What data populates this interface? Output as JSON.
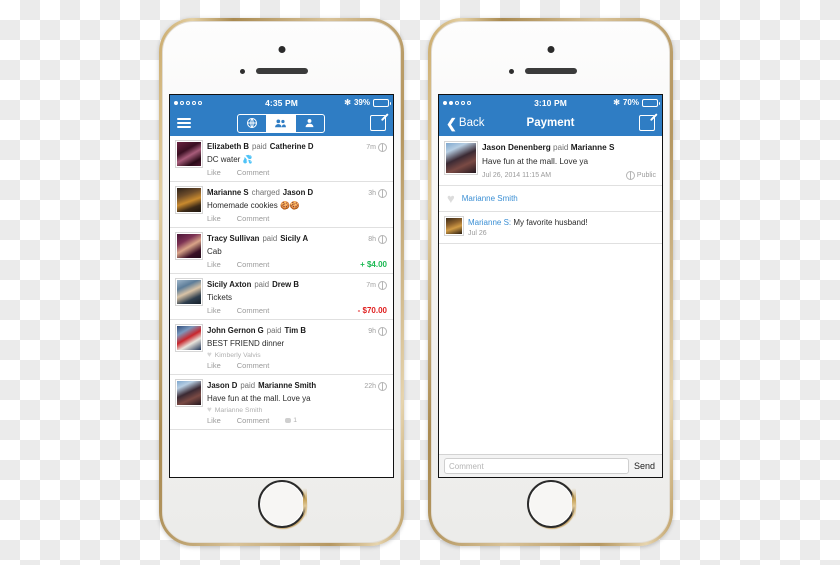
{
  "phone_left": {
    "status_bar": {
      "signal_dots_total": 5,
      "signal_dots_filled": 1,
      "time": "4:35 PM",
      "bluetooth_icon": "bluetooth-icon",
      "battery_percent": "39%",
      "battery_fill_color": "#4cd964",
      "battery_level": 39
    },
    "nav_bar": {
      "menu_icon": "hamburger-menu-icon",
      "segments": [
        {
          "icon": "globe-icon",
          "selected": false
        },
        {
          "icon": "people-group-icon",
          "selected": true
        },
        {
          "icon": "person-icon",
          "selected": false
        }
      ],
      "compose_icon": "compose-pencil-icon"
    },
    "feed": [
      {
        "avatar": "av-eliz",
        "actor": "Elizabeth B",
        "verb": "paid",
        "recipient": "Catherine D",
        "time": "7m",
        "privacy_icon": "globe-icon",
        "note": "DC water",
        "note_emoji": "💦",
        "liker": null,
        "actions": [
          "Like",
          "Comment"
        ],
        "amount": null,
        "amount_color": null,
        "comment_count": null
      },
      {
        "avatar": "av-mari",
        "actor": "Marianne S",
        "verb": "charged",
        "recipient": "Jason D",
        "time": "3h",
        "privacy_icon": "globe-icon",
        "note": "Homemade cookies",
        "note_emoji": "🍪🍪",
        "liker": null,
        "actions": [
          "Like",
          "Comment"
        ],
        "amount": null,
        "amount_color": null,
        "comment_count": null
      },
      {
        "avatar": "av-tracy",
        "actor": "Tracy Sullivan",
        "verb": "paid",
        "recipient": "Sicily A",
        "time": "8h",
        "privacy_icon": "globe-icon",
        "note": "Cab",
        "note_emoji": "",
        "liker": null,
        "actions": [
          "Like",
          "Comment"
        ],
        "amount": "+ $4.00",
        "amount_color": "#1db954",
        "comment_count": null
      },
      {
        "avatar": "av-sicily",
        "actor": "Sicily Axton",
        "verb": "paid",
        "recipient": "Drew B",
        "time": "7m",
        "privacy_icon": "globe-icon",
        "note": "Tickets",
        "note_emoji": "",
        "liker": null,
        "actions": [
          "Like",
          "Comment"
        ],
        "amount": "- $70.00",
        "amount_color": "#e02020",
        "comment_count": null
      },
      {
        "avatar": "av-john",
        "actor": "John Gernon G",
        "verb": "paid",
        "recipient": "Tim B",
        "time": "9h",
        "privacy_icon": "globe-icon",
        "note": "BEST FRIEND dinner",
        "note_emoji": "",
        "liker": "Kimberly Valvis",
        "actions": [
          "Like",
          "Comment"
        ],
        "amount": null,
        "amount_color": null,
        "comment_count": null
      },
      {
        "avatar": "av-jason",
        "actor": "Jason D",
        "verb": "paid",
        "recipient": "Marianne Smith",
        "time": "22h",
        "privacy_icon": "globe-icon",
        "note": "Have fun at the mall. Love ya",
        "note_emoji": "",
        "liker": "Marianne Smith",
        "actions": [
          "Like",
          "Comment"
        ],
        "amount": null,
        "amount_color": null,
        "comment_count": "1"
      }
    ]
  },
  "phone_right": {
    "status_bar": {
      "signal_dots_total": 5,
      "signal_dots_filled": 2,
      "time": "3:10 PM",
      "bluetooth_icon": "bluetooth-icon",
      "battery_percent": "70%",
      "battery_fill_color": "#ffffff",
      "battery_level": 70
    },
    "nav_bar": {
      "back_label": "Back",
      "back_icon": "chevron-left-icon",
      "title": "Payment",
      "compose_icon": "compose-pencil-icon"
    },
    "detail": {
      "avatar": "av-jason",
      "actor": "Jason Denenberg",
      "verb": "paid",
      "recipient": "Marianne S",
      "note": "Have fun at the mall. Love ya",
      "timestamp": "Jul 26, 2014 11:15 AM",
      "privacy_icon": "globe-icon",
      "privacy_label": "Public"
    },
    "like": {
      "heart_icon": "heart-icon",
      "name": "Marianne Smith"
    },
    "comments": [
      {
        "avatar": "av-marismall",
        "author": "Marianne S:",
        "text": "My favorite husband!",
        "date": "Jul 26"
      }
    ],
    "compose_bar": {
      "placeholder": "Comment",
      "value": "",
      "send_label": "Send"
    }
  }
}
